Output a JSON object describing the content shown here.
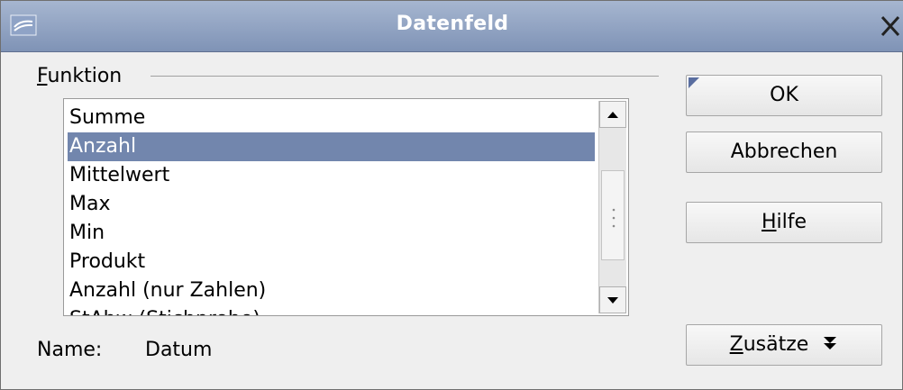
{
  "window": {
    "title": "Datenfeld"
  },
  "group": {
    "label_first": "F",
    "label_rest": "unktion"
  },
  "list": {
    "items": [
      "Summe",
      "Anzahl",
      "Mittelwert",
      "Max",
      "Min",
      "Produkt",
      "Anzahl (nur Zahlen)",
      "StAbw (Stichprobe)"
    ],
    "selected_index": 1
  },
  "scrollbar": {
    "position_fraction": 0.62
  },
  "name": {
    "label": "Name:",
    "value": "Datum"
  },
  "buttons": {
    "ok": "OK",
    "cancel": "Abbrechen",
    "help_first": "H",
    "help_rest": "ilfe",
    "options_first": "Z",
    "options_rest": "usätze"
  }
}
